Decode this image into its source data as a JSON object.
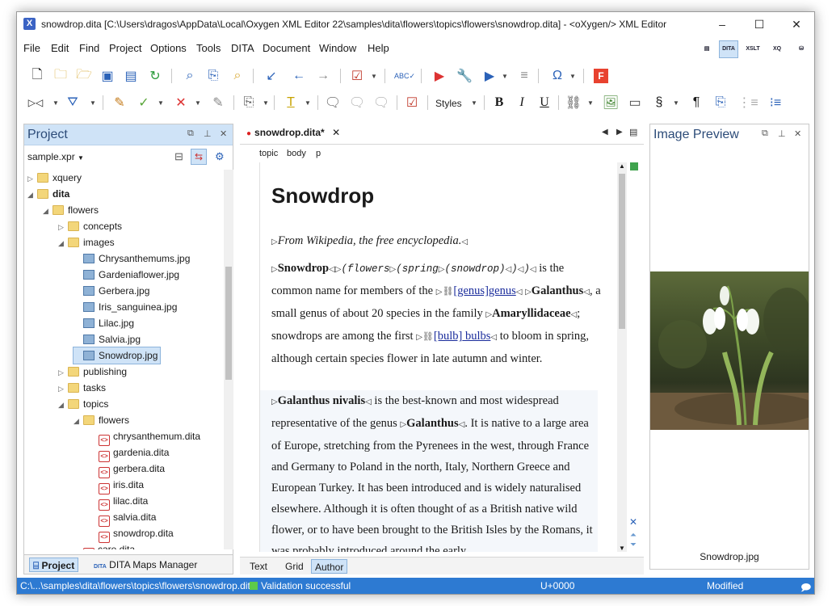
{
  "window": {
    "title": "snowdrop.dita [C:\\Users\\dragos\\AppData\\Local\\Oxygen XML Editor 22\\samples\\dita\\flowers\\topics\\flowers\\snowdrop.dita] - <oXygen/> XML Editor",
    "controls": [
      "–",
      "☐",
      "✕"
    ]
  },
  "menu": [
    "File",
    "Edit",
    "Find",
    "Project",
    "Options",
    "Tools",
    "DITA",
    "Document",
    "Window",
    "Help"
  ],
  "perspectives": [
    "DITA",
    "XSLT",
    "XQ"
  ],
  "toolbar": {
    "styles_label": "Styles"
  },
  "project_panel": {
    "title": "Project",
    "project_file": "sample.xpr",
    "tree": [
      {
        "label": "xquery",
        "kind": "folder",
        "level": 1,
        "expanded": false
      },
      {
        "label": "dita",
        "kind": "folder",
        "level": 1,
        "expanded": true,
        "bold": true
      },
      {
        "label": "flowers",
        "kind": "folder",
        "level": 2,
        "expanded": true
      },
      {
        "label": "concepts",
        "kind": "folder",
        "level": 3,
        "expanded": false
      },
      {
        "label": "images",
        "kind": "folder",
        "level": 3,
        "expanded": true
      },
      {
        "label": "Chrysanthemums.jpg",
        "kind": "image",
        "level": 4
      },
      {
        "label": "Gardeniaflower.jpg",
        "kind": "image",
        "level": 4
      },
      {
        "label": "Gerbera.jpg",
        "kind": "image",
        "level": 4
      },
      {
        "label": "Iris_sanguinea.jpg",
        "kind": "image",
        "level": 4
      },
      {
        "label": "Lilac.jpg",
        "kind": "image",
        "level": 4
      },
      {
        "label": "Salvia.jpg",
        "kind": "image",
        "level": 4
      },
      {
        "label": "Snowdrop.jpg",
        "kind": "image",
        "level": 4,
        "selected": true
      },
      {
        "label": "publishing",
        "kind": "folder",
        "level": 3,
        "expanded": false
      },
      {
        "label": "tasks",
        "kind": "folder",
        "level": 3,
        "expanded": false
      },
      {
        "label": "topics",
        "kind": "folder",
        "level": 3,
        "expanded": true
      },
      {
        "label": "flowers",
        "kind": "folder",
        "level": 4,
        "expanded": true
      },
      {
        "label": "chrysanthemum.dita",
        "kind": "dita",
        "level": 5
      },
      {
        "label": "gardenia.dita",
        "kind": "dita",
        "level": 5
      },
      {
        "label": "gerbera.dita",
        "kind": "dita",
        "level": 5
      },
      {
        "label": "iris.dita",
        "kind": "dita",
        "level": 5
      },
      {
        "label": "lilac.dita",
        "kind": "dita",
        "level": 5
      },
      {
        "label": "salvia.dita",
        "kind": "dita",
        "level": 5
      },
      {
        "label": "snowdrop.dita",
        "kind": "dita",
        "level": 5
      },
      {
        "label": "care.dita",
        "kind": "dita",
        "level": 4
      }
    ],
    "bottom_tabs": [
      "Project",
      "DITA Maps Manager"
    ]
  },
  "editor": {
    "tab_label": "snowdrop.dita*",
    "breadcrumb": [
      "topic",
      "body",
      "p"
    ],
    "doc_title": "Snowdrop",
    "short": "From Wikipedia, the free encyclopedia.",
    "p1": {
      "term": "Snowdrop",
      "flowers": "(flowers",
      "spring": "(spring",
      "snowdrop": "(snowdrop)",
      "close1": ")",
      "close2": ")",
      "t1": "is the common name for members of the",
      "genus_a": "[genus]",
      "genus_b": "genus",
      "galanthus": "Galanthus",
      "t2": ", a small genus of about 20 species in the family",
      "amaryl": "Amaryllidaceae",
      "t3": "; snowdrops are among the first",
      "bulb_a": "[bulb]",
      "bulb_b": "bulbs",
      "t4": "to bloom in spring, although certain species flower in late autumn and winter."
    },
    "p2": {
      "term": "Galanthus nivalis",
      "t1": "is the best-known and most widespread representative of the genus",
      "galanthus": "Galanthus",
      "t2": ". It is native to a large area of Europe, stretching from the Pyrenees in the west, through France and Germany to Poland in the north, Italy, Northern Greece and European Turkey. It has been introduced and is widely naturalised elsewhere. Although it is often thought of as a British native wild flower, or to have been brought to the British Isles by the Romans, it was probably introduced around the early"
    },
    "bottom_tabs": [
      "Text",
      "Grid",
      "Author"
    ],
    "active_tab": "Author"
  },
  "image_preview": {
    "title": "Image Preview",
    "caption": "Snowdrop.jpg"
  },
  "status": {
    "path": "C:\\...\\samples\\dita\\flowers\\topics\\flowers\\snowdrop.dita",
    "validation": "Validation successful",
    "unicode": "U+0000",
    "state": "Modified"
  }
}
